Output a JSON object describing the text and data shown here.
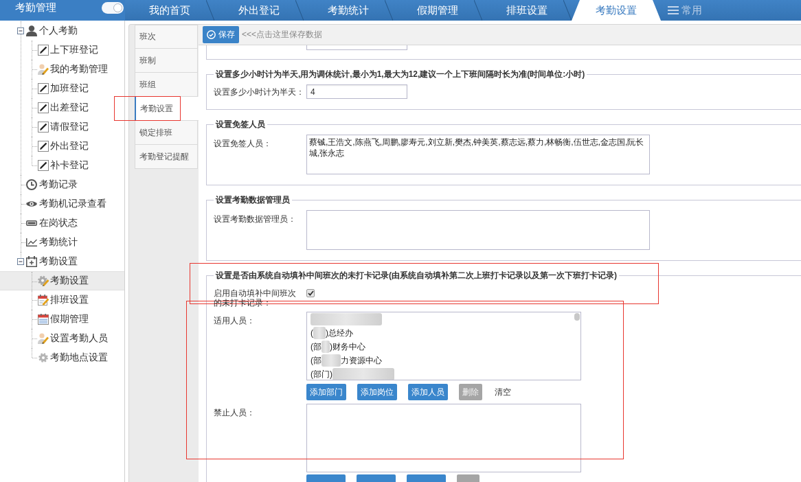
{
  "header": {
    "title": "考勤管理",
    "toggle": {
      "on": true
    },
    "tabs": [
      {
        "label": "我的首页",
        "selected": false
      },
      {
        "label": "外出登记",
        "selected": false
      },
      {
        "label": "考勤统计",
        "selected": false
      },
      {
        "label": "假期管理",
        "selected": false
      },
      {
        "label": "排班设置",
        "selected": false
      },
      {
        "label": "考勤设置",
        "selected": true
      }
    ],
    "quick_menu": {
      "label": "常用"
    }
  },
  "sidebar": {
    "items": [
      {
        "label": "个人考勤",
        "selected": false,
        "expanded": true,
        "children": [
          {
            "label": "上下班登记",
            "selected": false
          },
          {
            "label": "我的考勤管理",
            "selected": false
          },
          {
            "label": "加班登记",
            "selected": false
          },
          {
            "label": "出差登记",
            "selected": false
          },
          {
            "label": "请假登记",
            "selected": false
          },
          {
            "label": "外出登记",
            "selected": false
          },
          {
            "label": "补卡登记",
            "selected": false
          }
        ]
      },
      {
        "label": "考勤记录",
        "selected": false
      },
      {
        "label": "考勤机记录查看",
        "selected": false
      },
      {
        "label": "在岗状态",
        "selected": false
      },
      {
        "label": "考勤统计",
        "selected": false
      },
      {
        "label": "考勤设置",
        "selected": false,
        "expanded": true,
        "children": [
          {
            "label": "考勤设置",
            "selected": true
          },
          {
            "label": "排班设置",
            "selected": false
          },
          {
            "label": "假期管理",
            "selected": false
          },
          {
            "label": "设置考勤人员",
            "selected": false
          },
          {
            "label": "考勤地点设置",
            "selected": false
          }
        ]
      }
    ]
  },
  "side_tabs": [
    {
      "label": "班次",
      "selected": false
    },
    {
      "label": "班制",
      "selected": false
    },
    {
      "label": "班组",
      "selected": false
    },
    {
      "label": "考勤设置",
      "selected": true
    },
    {
      "label": "锁定排班",
      "selected": false
    },
    {
      "label": "考勤登记提醒",
      "selected": false
    }
  ],
  "toolbar": {
    "save_label": "保存",
    "hint": "<<<点击这里保存数据"
  },
  "sections": [
    {
      "kind": "cut"
    },
    {
      "kind": "input",
      "legend": "设置多少小时计为半天,用为调休统计,最小为1,最大为12,建议一个上下班间隔时长为准(时间单位:小时)",
      "label": "设置多少小时计为半天：",
      "value": "4"
    },
    {
      "kind": "textarea",
      "legend": "设置免签人员",
      "label": "设置免签人员：",
      "value": "蔡铖,王浩文,陈燕飞,周鹏,廖寿元,刘立新,樊杰,钟美英,蔡志远,蔡力,林畅衡,伍世志,金志国,阮长城,张永志"
    },
    {
      "kind": "textarea",
      "legend": "设置考勤数据管理员",
      "label": "设置考勤数据管理员："
    },
    {
      "kind": "autofill",
      "legend": "设置是否由系统自动填补中间班次的未打卡记录(由系统自动填补第二次上班打卡记录以及第一次下班打卡记录)",
      "checkbox": {
        "label": "启用自动填补中间班次的未打卡记录：",
        "checked": true
      },
      "applicable": {
        "label": "适用人员：",
        "options": [
          {
            "redacted": true
          },
          {
            "before": "(",
            "redacted": true,
            "after": ")总经办"
          },
          {
            "before": "(部",
            "redacted": true,
            "after": ")财务中心"
          },
          {
            "before": "(部",
            "redacted": true,
            "after": "力资源中心"
          },
          {
            "before": "(部门)",
            "redacted": true
          }
        ],
        "buttons": [
          {
            "kind": "button",
            "label": "添加部门",
            "disabled": false
          },
          {
            "kind": "button",
            "label": "添加岗位",
            "disabled": false
          },
          {
            "kind": "button",
            "label": "添加人员",
            "disabled": false
          },
          {
            "kind": "button",
            "label": "删除",
            "disabled": true
          },
          {
            "kind": "link",
            "label": "清空",
            "disabled": false
          }
        ]
      },
      "excluded": {
        "label": "禁止人员：",
        "buttons": [
          {
            "kind": "button",
            "disabled": false
          },
          {
            "kind": "button",
            "disabled": false
          },
          {
            "kind": "button",
            "disabled": false
          },
          {
            "kind": "button",
            "disabled": true
          }
        ]
      }
    }
  ],
  "annotations": [
    {
      "kind": "box"
    },
    {
      "kind": "box"
    },
    {
      "kind": "box"
    }
  ]
}
